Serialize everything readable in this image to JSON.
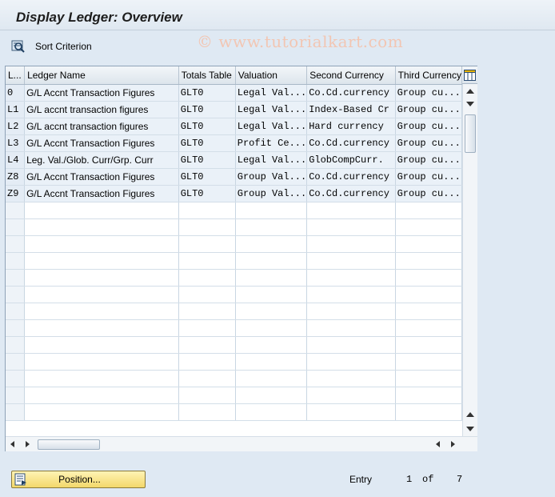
{
  "window": {
    "title": "Display Ledger: Overview",
    "watermark": "© www.tutorialkart.com"
  },
  "toolbar": {
    "sort_label": "Sort Criterion"
  },
  "table": {
    "columns": [
      "L...",
      "Ledger Name",
      "Totals Table",
      "Valuation",
      "Second Currency",
      "Third Currency"
    ],
    "rows": [
      [
        "0",
        "G/L Accnt Transaction Figures",
        "GLT0",
        "Legal Val...",
        "Co.Cd.currency",
        "Group cu..."
      ],
      [
        "L1",
        "G/L accnt transaction figures",
        "GLT0",
        "Legal Val...",
        "Index-Based Cr",
        "Group cu..."
      ],
      [
        "L2",
        "G/L accnt transaction figures",
        "GLT0",
        "Legal Val...",
        "Hard currency",
        "Group cu..."
      ],
      [
        "L3",
        "G/L Accnt Transaction Figures",
        "GLT0",
        "Profit Ce...",
        "Co.Cd.currency",
        "Group cu..."
      ],
      [
        "L4",
        "Leg. Val./Glob. Curr/Grp. Curr",
        "GLT0",
        "Legal Val...",
        "GlobCompCurr.",
        "Group cu..."
      ],
      [
        "Z8",
        "G/L Accnt Transaction Figures",
        "GLT0",
        "Group Val...",
        "Co.Cd.currency",
        "Group cu..."
      ],
      [
        "Z9",
        "G/L Accnt Transaction Figures",
        "GLT0",
        "Group Val...",
        "Co.Cd.currency",
        "Group cu..."
      ]
    ],
    "empty_rows": 13
  },
  "footer": {
    "position_label": "Position...",
    "entry_label": "Entry",
    "entry_current": "1",
    "entry_of": "of",
    "entry_total": "7"
  }
}
